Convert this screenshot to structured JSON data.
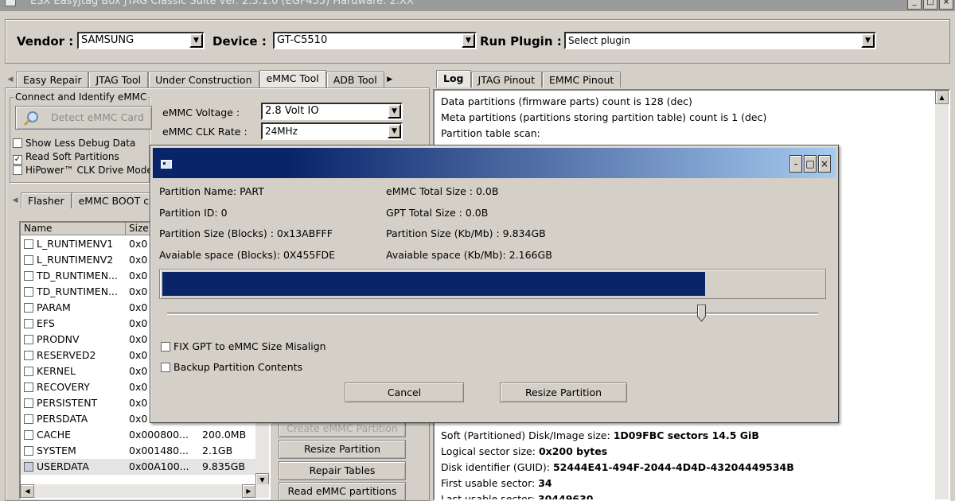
{
  "window": {
    "title": "ESX EasyJtag Box JTAG Classic Suite ver. 2.3.1.0 (EGF455) Hardware: 2.XX"
  },
  "toolbar": {
    "vendor_label": "Vendor :",
    "vendor_value": "SAMSUNG",
    "device_label": "Device :",
    "device_value": "GT-C5510",
    "plugin_label": "Run Plugin :",
    "plugin_value": "Select plugin"
  },
  "left_tabs": [
    "Easy Repair",
    "JTAG Tool",
    "Under Construction",
    "eMMC Tool",
    "ADB Tool"
  ],
  "left_tabs_active": 3,
  "connect_group": {
    "title": "Connect and Identify eMMC",
    "detect_button": "Detect eMMC Card",
    "voltage_label": "eMMC Voltage :",
    "voltage_value": "2.8 Volt IO",
    "clk_label": "eMMC CLK Rate :",
    "clk_value": "24MHz",
    "show_less_debug": "Show Less Debug Data",
    "read_soft_partitions": "Read Soft Partitions",
    "hipower": "HiPower™ CLK Drive Mode"
  },
  "checks": {
    "show_less_debug": false,
    "read_soft_partitions": true,
    "hipower": false
  },
  "sub_tabs": [
    "Flasher",
    "eMMC BOOT c"
  ],
  "partition_list": {
    "headers": [
      "Name",
      "Size"
    ],
    "rows": [
      {
        "name": "L_RUNTIMENV1",
        "start": "0x0",
        "size": ""
      },
      {
        "name": "L_RUNTIMENV2",
        "start": "0x0",
        "size": ""
      },
      {
        "name": "TD_RUNTIMEN...",
        "start": "0x0",
        "size": ""
      },
      {
        "name": "TD_RUNTIMEN...",
        "start": "0x0",
        "size": ""
      },
      {
        "name": "PARAM",
        "start": "0x0",
        "size": ""
      },
      {
        "name": "EFS",
        "start": "0x0",
        "size": ""
      },
      {
        "name": "PRODNV",
        "start": "0x0",
        "size": ""
      },
      {
        "name": "RESERVED2",
        "start": "0x0",
        "size": ""
      },
      {
        "name": "KERNEL",
        "start": "0x0",
        "size": ""
      },
      {
        "name": "RECOVERY",
        "start": "0x0",
        "size": ""
      },
      {
        "name": "PERSISTENT",
        "start": "0x0",
        "size": ""
      },
      {
        "name": "PERSDATA",
        "start": "0x0",
        "size": ""
      },
      {
        "name": "CACHE",
        "start": "0x000800...",
        "size": "200.0MB"
      },
      {
        "name": "SYSTEM",
        "start": "0x001480...",
        "size": "2.1GB"
      },
      {
        "name": "USERDATA",
        "start": "0x00A100...",
        "size": "9.835GB"
      }
    ],
    "selected_index": 14
  },
  "action_buttons": {
    "create": "Create eMMC Partition",
    "resize": "Resize Partition",
    "repair": "Repair Tables",
    "read": "Read eMMC partitions"
  },
  "right_tabs": [
    "Log",
    "JTAG Pinout",
    "EMMC Pinout"
  ],
  "log": {
    "top_lines": [
      "Data partitions (firmware parts) count is 128 (dec)",
      "Meta partitions (partitions storing partition table) count is 1 (dec)",
      "Partition table scan:"
    ],
    "bottom_lines": [
      {
        "label": "Soft (Partitioned) Disk/Image size: ",
        "value": "1D09FBC sectors 14.5 GiB"
      },
      {
        "label": "Logical sector size: ",
        "value": "0x200  bytes"
      },
      {
        "label": "Disk identifier (GUID): ",
        "value": "52444E41-494F-2044-4D4D-43204449534B"
      },
      {
        "label": "First usable sector: ",
        "value": "34"
      },
      {
        "label": "Last usable sector: ",
        "value": "30449630"
      }
    ]
  },
  "dialog": {
    "partition_name": "Partition Name: PART",
    "partition_id": "Partition ID: 0",
    "partition_size_blocks": "Partition Size (Blocks) : 0x13ABFFF",
    "available_blocks": "Avaiable space (Blocks): 0X455FDE",
    "emmc_total": "eMMC Total Size : 0.0B",
    "gpt_total": "GPT Total Size : 0.0B",
    "partition_size_kb": "Partition Size (Kb/Mb) : 9.834GB",
    "available_kb": "Avaiable space (Kb/Mb): 2.166GB",
    "progress_fraction": 0.82,
    "slider_fraction": 0.82,
    "fix_gpt": "FIX GPT to eMMC Size Misalign",
    "backup": "Backup Partition Contents",
    "cancel_button": "Cancel",
    "resize_button": "Resize Partition"
  },
  "colors": {
    "accent": "#0a246a",
    "face": "#d4d0c8"
  }
}
